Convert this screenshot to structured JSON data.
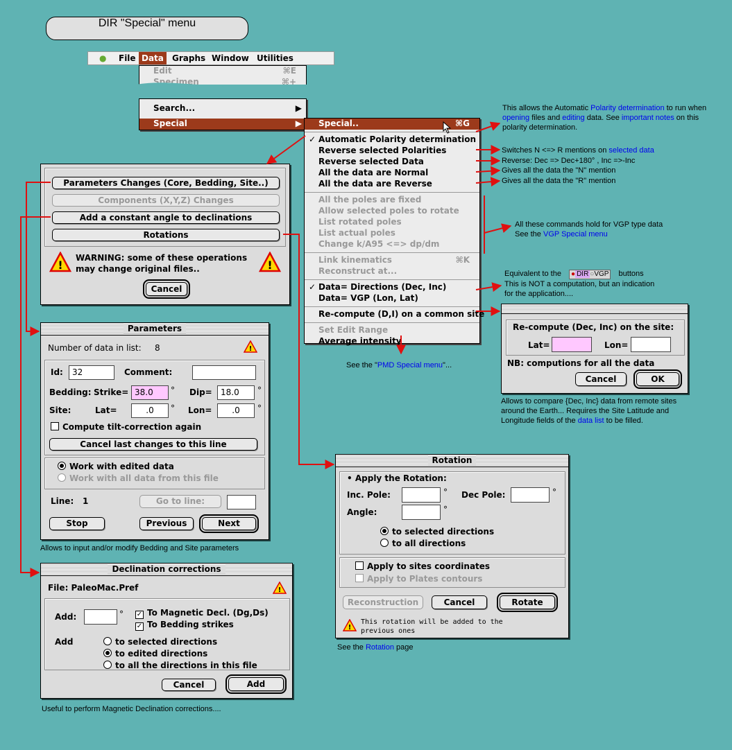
{
  "title_pill": "DIR \"Special\" menu",
  "menubar": {
    "items": [
      "File",
      "Data",
      "Graphs",
      "Window",
      "Utilities"
    ]
  },
  "data_menu": {
    "edit": "Edit",
    "edit_sc": "⌘E",
    "specimen": "Specimen",
    "specimen_sc": "⌘+",
    "search": "Search...",
    "special": "Special"
  },
  "special_menu": {
    "header": "Special..",
    "header_sc": "⌘G",
    "g1": [
      "Automatic Polarity determination",
      "Reverse selected Polarities",
      "Reverse selected Data",
      "All the data are Normal",
      "All the data are Reverse"
    ],
    "g2": [
      "All the poles are fixed",
      "Allow selected poles to rotate",
      "List rotated poles",
      "List actual poles",
      "Change k/A95 <=> dp/dm"
    ],
    "g3": [
      "Link kinematics",
      "Reconstruct at..."
    ],
    "g3_sc": "⌘K",
    "g4": [
      "Data= Directions (Dec, Inc)",
      "Data= VGP (Lon, Lat)"
    ],
    "g5": [
      "Re-compute (D,I) on a common site"
    ],
    "g6": [
      "Set Edit Range",
      "Average intensity"
    ]
  },
  "notes": {
    "polarity_1": "This allows the Automatic ",
    "polarity_link": "Polarity determination",
    "polarity_2": " to run when",
    "polarity_3": "opening",
    "polarity_4": " files and ",
    "polarity_5": "editing",
    "polarity_6": " data. See ",
    "polarity_7": "important notes",
    "polarity_8": " on this",
    "polarity_9": "polarity determination.",
    "switch_1": "Switches N <=> R mentions on ",
    "switch_link": "selected data",
    "reverse": "Reverse: Dec => Dec+180° , Inc =>-Inc",
    "normal": "Gives all the data the \"N\" mention",
    "rev_all": "Gives all the data the \"R\" mention",
    "vgp_1": "All these commands hold for VGP type data",
    "vgp_2": "See the ",
    "vgp_link": "VGP Special menu",
    "equiv_1": "Equivalent to the",
    "equiv_dir": "DIR",
    "equiv_vgp": "VGP",
    "equiv_2": "buttons",
    "equiv_3": "This is NOT a computation, but an indication",
    "equiv_4": "for the application....",
    "pmd_1": "See the \"",
    "pmd_link": "PMD Special menu",
    "pmd_2": "\"...",
    "remote_1": "Allows to compare {Dec, Inc} data from remote sites",
    "remote_2": "around the Earth...    Requires the Site Latitude and",
    "remote_3": "Longitude fields of the ",
    "remote_link": "data list",
    "remote_4": " to be filled.",
    "bedding": "Allows to input and/or modify Bedding and Site parameters",
    "rotation_1": "See the ",
    "rotation_link": "Rotation",
    "rotation_2": " page",
    "decl": "Useful to perform Magnetic Declination corrections...."
  },
  "rot_dialog": {
    "btn_params": "Parameters Changes (Core, Bedding, Site..)",
    "btn_comp": "Components (X,Y,Z) Changes",
    "btn_angle": "Add a constant angle to declinations",
    "btn_rot": "Rotations",
    "warn_1": "WARNING:     some of these operations",
    "warn_2": "may change original files..",
    "cancel": "Cancel"
  },
  "params": {
    "title": "Parameters",
    "ndata_label": "Number of data in list:",
    "ndata": "8",
    "id_label": "Id:",
    "id": "32",
    "comment_label": "Comment:",
    "comment": "",
    "bedding_label": "Bedding:",
    "strike_label": "Strike=",
    "strike": "38.0",
    "dip_label": "Dip=",
    "dip": "18.0",
    "site_label": "Site:",
    "lat_label": "Lat=",
    "lat": ".0",
    "lon_label": "Lon=",
    "lon": ".0",
    "deg": "°",
    "tilt": "Compute tilt-correction again",
    "cancel_last": "Cancel last changes to this line",
    "work_edit": "Work with edited data",
    "work_all": "Work with all data from this file",
    "line_label": "Line:",
    "line": "1",
    "goto": "Go to line:",
    "stop": "Stop",
    "prev": "Previous",
    "next": "Next"
  },
  "recompute": {
    "title": "Re-compute (Dec, Inc) on the site:",
    "lat_label": "Lat=",
    "lon_label": "Lon=",
    "nb": "NB: computions for all the data",
    "cancel": "Cancel",
    "ok": "OK"
  },
  "rotation": {
    "title": "Rotation",
    "apply": "• Apply the Rotation:",
    "inc_label": "Inc. Pole:",
    "dec_label": "Dec Pole:",
    "angle_label": "Angle:",
    "deg": "°",
    "sel": "to selected directions",
    "all": "to all directions",
    "sites": "Apply to sites coordinates",
    "plates": "Apply to Plates contours",
    "recon": "Reconstruction",
    "cancel": "Cancel",
    "rotate": "Rotate",
    "warn_1": "This rotation will be added to the",
    "warn_2": "previous ones"
  },
  "decl": {
    "title": "Declination corrections",
    "file": "File: PaleoMac.Pref",
    "add_label": "Add:",
    "deg": "°",
    "to_mag": "To Magnetic Decl. (Dg,Ds)",
    "to_bed": "To Bedding strikes",
    "add2": "Add",
    "r1": "to selected directions",
    "r2": "to edited directions",
    "r3": "to all the directions in this file",
    "cancel": "Cancel",
    "add_btn": "Add"
  },
  "colors": {
    "background": "#5fb3b3",
    "highlight": "#9c3a1b",
    "arrow": "#e01010",
    "link": "#0000ee",
    "pink": "#ffc8ff"
  }
}
